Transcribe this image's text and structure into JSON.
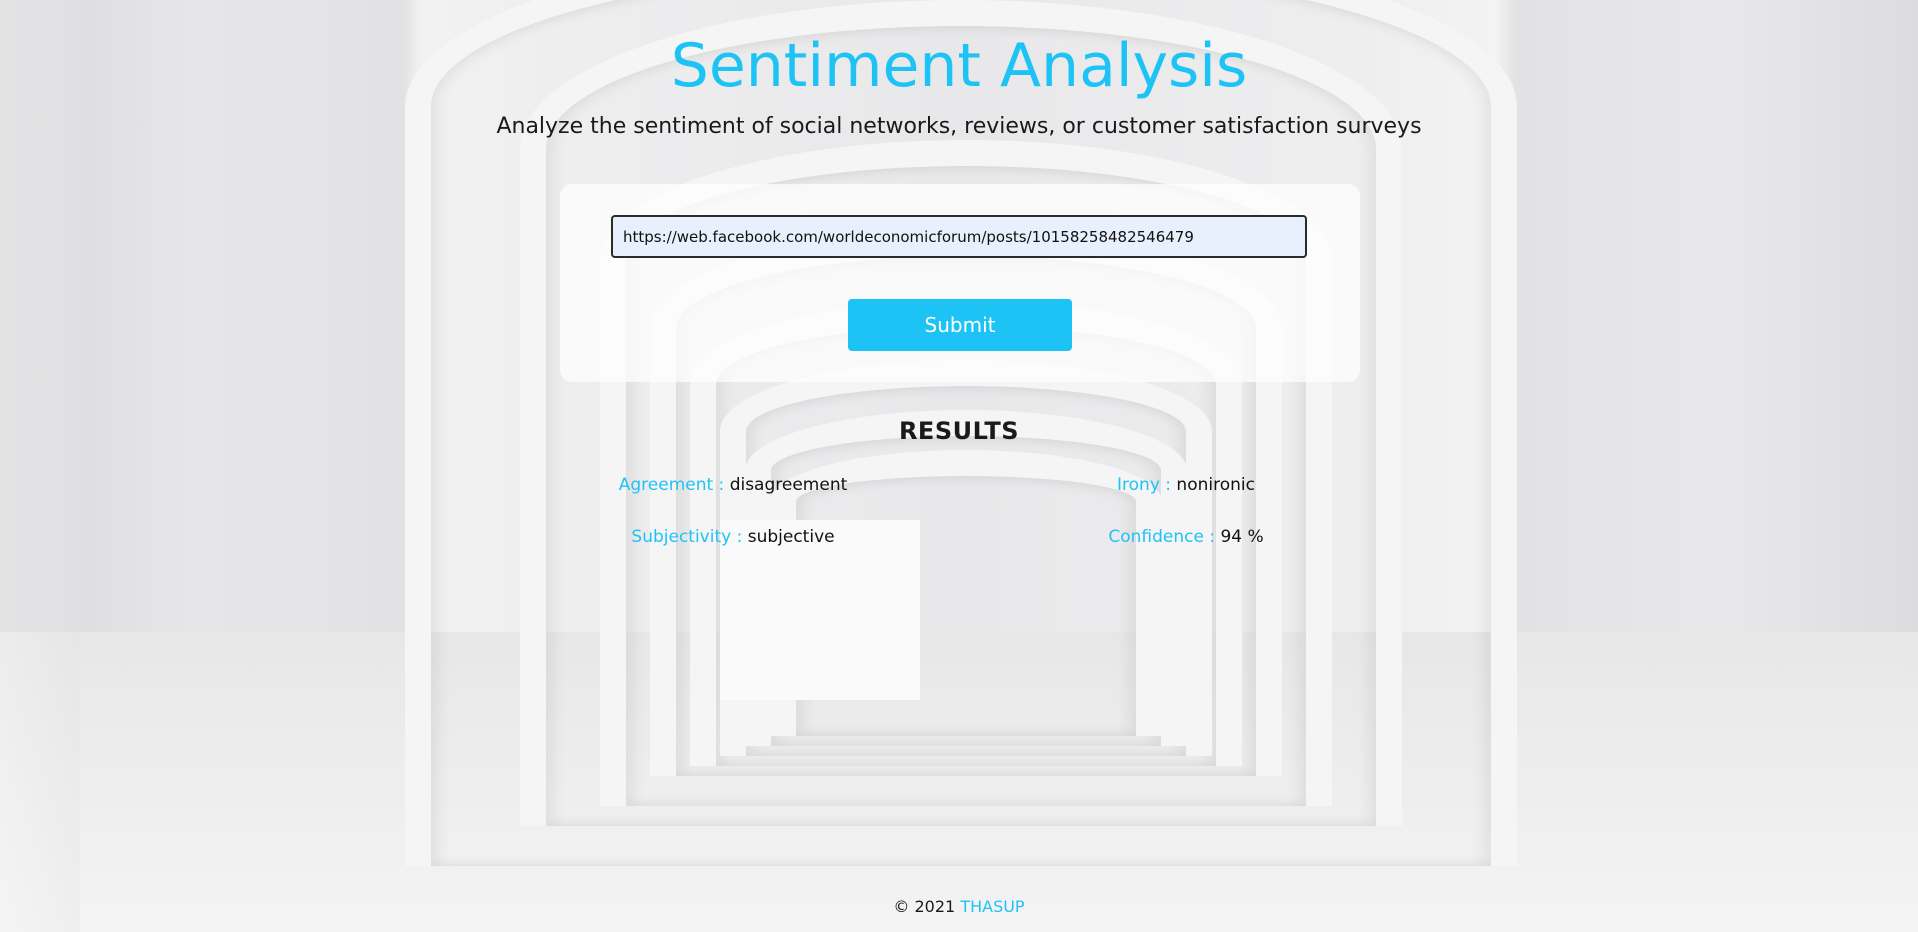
{
  "header": {
    "title": "Sentiment Analysis",
    "subtitle": "Analyze the sentiment of social networks, reviews, or customer satisfaction surveys"
  },
  "form": {
    "url_value": "https://web.facebook.com/worldeconomicforum/posts/10158258482546479",
    "submit_label": "Submit"
  },
  "results": {
    "heading": "RESULTS",
    "items": [
      {
        "label": "Agreement :",
        "value": "disagreement"
      },
      {
        "label": "Irony :",
        "value": "nonironic"
      },
      {
        "label": "Subjectivity :",
        "value": "subjective"
      },
      {
        "label": "Confidence :",
        "value": "94 %"
      }
    ]
  },
  "footer": {
    "copyright": "© 2021",
    "brand": "THASUP"
  },
  "colors": {
    "accent": "#1ec3f5",
    "text": "#1a1a1a"
  }
}
